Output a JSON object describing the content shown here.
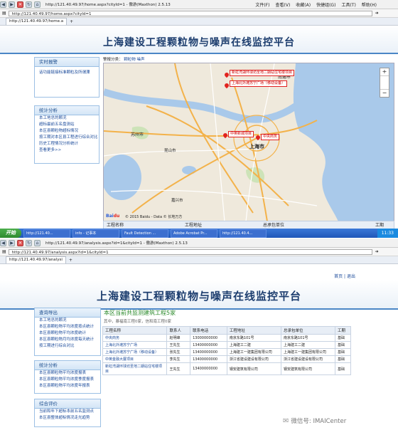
{
  "top": {
    "window_title": "http://121.40.49.97/home.aspx?cityId=1 - 傲游(Maxthon) 2.5.13",
    "menu": [
      "文件(F)",
      "查看(V)",
      "收藏(A)",
      "快捷组(G)",
      "工具(T)",
      "帮助(H)"
    ],
    "address": "http://121.40.49.97/home.aspx?cityId=1",
    "tab_label": "http://121.40.49.97/home.a",
    "site_title": "上海建设工程颗粒物与噪声在线监控平台",
    "alarm_box": {
      "title": "实时报警",
      "item": "话功能链接标准颗粒及所谓溧"
    },
    "stats_box": {
      "title": "统计分析",
      "items": [
        "本工地总的颗况",
        "超标最前五名盘测站",
        "本区县颗粒物超标情况",
        "按工期对本区县工程进行综合对比",
        "历史工程情况分析统计",
        "查看更多>>"
      ]
    },
    "filter": {
      "label": "警报分类：",
      "options": [
        "颗粒物",
        "噪声"
      ]
    },
    "map_markers": [
      "新虹湾湖环球坊圣地二期站住宅楼项目",
      "上海北外滩苏宁广场（移动设备）",
      "中英新城项目",
      "中央商务"
    ],
    "map_places": [
      "苏州市",
      "上海市",
      "南通市",
      "昆山市",
      "嘉兴市"
    ],
    "map_copyright": "© 2015 Baidu - Data © 长地万方",
    "table_header": [
      "工程名称",
      "工程地址",
      "总承包单位",
      "工期"
    ]
  },
  "taskbar": {
    "start": "开始",
    "tasks": [
      "http://121.40...",
      "info - 记事本",
      "Fault Detection ...",
      "Adobe Acrobat Pr...",
      "http://121.40.4..."
    ],
    "clock": "11:33"
  },
  "bottom": {
    "window_title": "http://121.40.49.97/analysis.aspx?id=1&cityId=1 - 傲游(Maxthon) 2.5.13",
    "address": "http://121.40.49.97/analysis.aspx?id=1&cityId=1",
    "tab_label": "http://121.40.49.97/analysi",
    "top_links": [
      "首页",
      "退出"
    ],
    "site_title": "上海建设工程颗粒物与噪声在线监控平台",
    "query_box": {
      "title": "查询导出",
      "items": [
        "本工地总的颗况",
        "本区县颗粒物平均浓度按点统计",
        "本区县颗粒物平均浓度统计",
        "本区县颗粒物月均浓度每天统计",
        "按工期进行综合对比"
      ]
    },
    "stats_box": {
      "title": "统计分析",
      "items": [
        "本区县颗粒物平均浓度报表",
        "本区县颗粒物平均浓度季度报表",
        "本区县颗粒物平均浓度年报表"
      ]
    },
    "eval_box": {
      "title": "综合评价",
      "items": [
        "当前和年下超标本前五名监测点",
        "本区县整体超标情况走光趋势"
      ]
    },
    "heading": "本区当前共监测建筑工程5家",
    "subheading": "其中，暴福南工程0家，信和南工程0家",
    "columns": [
      "工程名称",
      "联系人",
      "联系电话",
      "工程地址",
      "总承包单位",
      "工期"
    ],
    "rows": [
      [
        "中央商务",
        "赵明峰",
        "13000000000",
        "南京东路101号",
        "南京东路101号",
        "基础"
      ],
      [
        "上海北外滩苏宁广场",
        "王先生",
        "13400000000",
        "上海建工二建",
        "上海建工二建",
        "基础"
      ],
      [
        "上海北外滩苏宁广场（移动设备）",
        "张先生",
        "13400000000",
        "上海建工一建集团有限公司",
        "上海建工一建集团有限公司",
        "基础"
      ],
      [
        "中英金融大厦项目",
        "李先生",
        "13400000000",
        "浙江省建设建设有限公司",
        "浙江省建设建设有限公司",
        "基础"
      ],
      [
        "新虹湾湖环球坊圣地二期站住宅楼项目",
        "王先生",
        "13400000000",
        "钢安建筑有限公司",
        "钢安建筑有限公司",
        "基础"
      ]
    ],
    "watermark": "微信号: IMAICenter"
  }
}
